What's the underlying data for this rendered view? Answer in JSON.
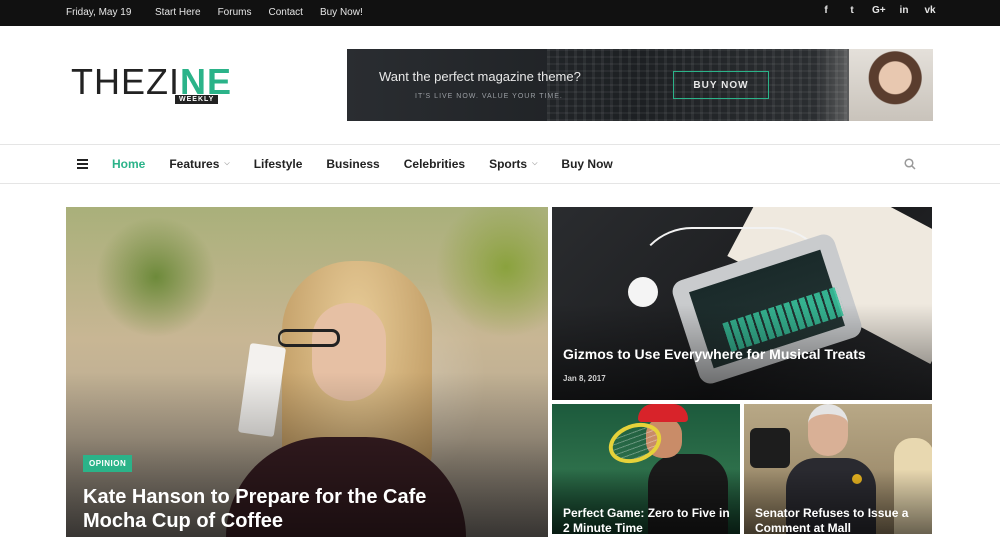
{
  "topbar": {
    "date": "Friday, May 19",
    "links": [
      "Start Here",
      "Forums",
      "Contact",
      "Buy Now!"
    ],
    "social": [
      "f",
      "t",
      "G+",
      "in",
      "vk"
    ]
  },
  "logo": {
    "the": "THE",
    "zi": "ZI",
    "ne": "NE",
    "tagline": "WEEKLY"
  },
  "banner": {
    "headline": "Want the perfect magazine theme?",
    "sub": "IT'S LIVE NOW. VALUE YOUR TIME.",
    "button": "BUY NOW"
  },
  "nav": {
    "items": [
      {
        "label": "Home",
        "active": true
      },
      {
        "label": "Features",
        "dropdown": true
      },
      {
        "label": "Lifestyle"
      },
      {
        "label": "Business"
      },
      {
        "label": "Celebrities"
      },
      {
        "label": "Sports",
        "dropdown": true
      },
      {
        "label": "Buy Now"
      }
    ]
  },
  "posts": {
    "hero": {
      "category": "OPINION",
      "title": "Kate Hanson to Prepare for the Cafe Mocha Cup of Coffee"
    },
    "gizmo": {
      "title": "Gizmos to Use Everywhere for Musical Treats",
      "date": "Jan 8, 2017"
    },
    "tennis": {
      "title": "Perfect Game: Zero to Five in 2 Minute Time"
    },
    "senator": {
      "title": "Senator Refuses to Issue a Comment at Mall"
    }
  },
  "colors": {
    "accent": "#2bb389",
    "topbar": "#111111"
  }
}
